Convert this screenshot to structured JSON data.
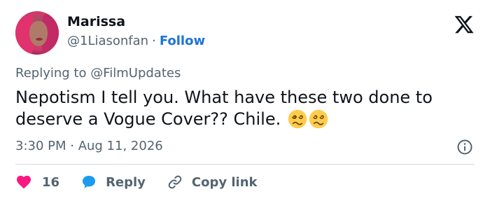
{
  "author": {
    "name": "Marissa",
    "handle": "@1Liasonfan",
    "separator": "·",
    "follow_label": "Follow"
  },
  "reply_context": {
    "prefix": "Replying to ",
    "mention": "@FilmUpdates"
  },
  "tweet": {
    "text": "Nepotism I tell you. What have these two done to deserve a Vogue Cover?? Chile.",
    "emojis": [
      "woozy-face-emoji",
      "woozy-face-emoji"
    ]
  },
  "meta": {
    "timestamp": "3:30 PM · Aug 11, 2026"
  },
  "actions": {
    "like_count": "16",
    "reply_label": "Reply",
    "copy_link_label": "Copy link"
  },
  "colors": {
    "accent": "#1d74d6",
    "like": "#f91880",
    "reply": "#1d9bf0",
    "muted": "#536471"
  }
}
